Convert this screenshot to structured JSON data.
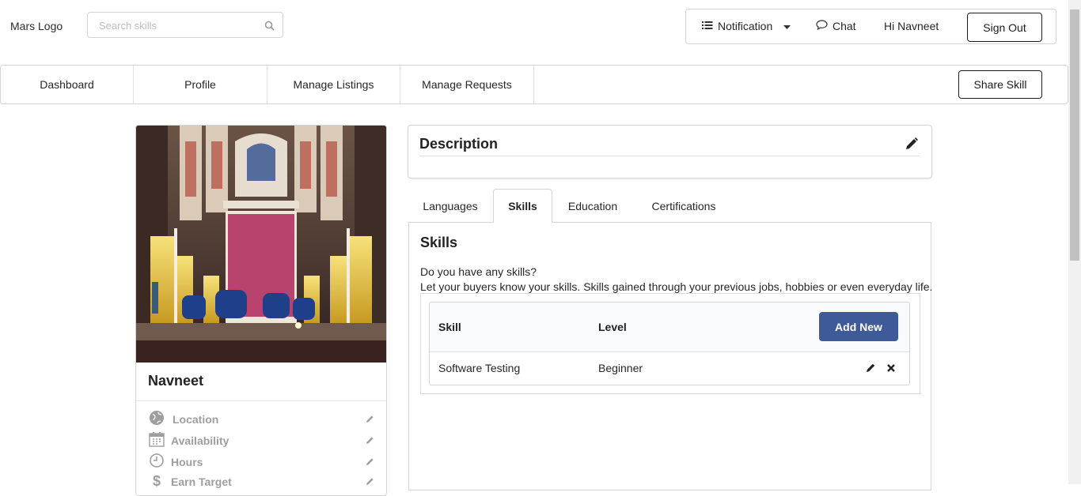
{
  "header": {
    "logo": "Mars Logo",
    "search_placeholder": "Search skills",
    "notification_label": "Notification",
    "chat_label": "Chat",
    "greeting": "Hi Navneet",
    "sign_out_label": "Sign Out"
  },
  "nav": {
    "tabs": [
      "Dashboard",
      "Profile",
      "Manage Listings",
      "Manage Requests"
    ],
    "share_skill_label": "Share Skill"
  },
  "profile": {
    "name": "Navneet",
    "fields": [
      "Location",
      "Availability",
      "Hours",
      "Earn Target"
    ]
  },
  "description": {
    "title": "Description"
  },
  "tabs": {
    "items": [
      "Languages",
      "Skills",
      "Education",
      "Certifications"
    ],
    "active": "Skills"
  },
  "skills": {
    "title": "Skills",
    "line1": "Do you have any skills?",
    "line2": "Let your buyers know your skills. Skills gained through your previous jobs, hobbies or even everyday life.",
    "col_skill": "Skill",
    "col_level": "Level",
    "add_new_label": "Add New",
    "rows": [
      {
        "skill": "Software Testing",
        "level": "Beginner"
      }
    ]
  },
  "colors": {
    "primary_button": "#3f5a98",
    "border": "#d4d4d5"
  },
  "icons": [
    "search-icon",
    "list-icon",
    "caret-down-icon",
    "chat-bubble-icon",
    "pencil-icon",
    "globe-icon",
    "calendar-icon",
    "clock-icon",
    "dollar-icon",
    "close-icon"
  ]
}
